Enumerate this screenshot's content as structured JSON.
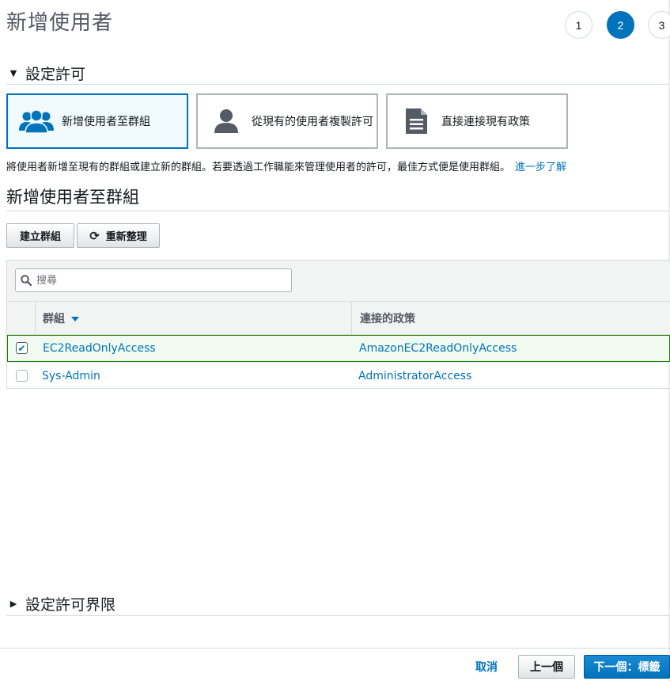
{
  "page": {
    "title": "新增使用者"
  },
  "steps": [
    "1",
    "2",
    "3"
  ],
  "sections": {
    "permissions": "設定許可",
    "boundary": "設定許可界限"
  },
  "options": [
    {
      "label": "新增使用者至群組",
      "icon": "users-group-icon",
      "selected": true
    },
    {
      "label": "從現有的使用者複製許可",
      "icon": "user-icon",
      "selected": false
    },
    {
      "label": "直接連接現有政策",
      "icon": "document-icon",
      "selected": false
    }
  ],
  "description": {
    "text": "將使用者新增至現有的群組或建立新的群組。若要透過工作職能來管理使用者的許可，最佳方式便是使用群組。",
    "link": "進一步了解"
  },
  "subsection": {
    "title": "新增使用者至群組"
  },
  "toolbar": {
    "create_label": "建立群組",
    "refresh_label": "重新整理"
  },
  "search": {
    "placeholder": "搜尋",
    "value": ""
  },
  "table": {
    "columns": [
      "群組",
      "連接的政策"
    ],
    "rows": [
      {
        "group": "EC2ReadOnlyAccess",
        "policy": "AmazonEC2ReadOnlyAccess",
        "checked": true
      },
      {
        "group": "Sys-Admin",
        "policy": "AdministratorAccess",
        "checked": false
      }
    ]
  },
  "footer": {
    "cancel": "取消",
    "previous": "上一個",
    "next": "下一個：標籤"
  },
  "colors": {
    "accent": "#0073bb",
    "selected_row_border": "#1d8102"
  }
}
